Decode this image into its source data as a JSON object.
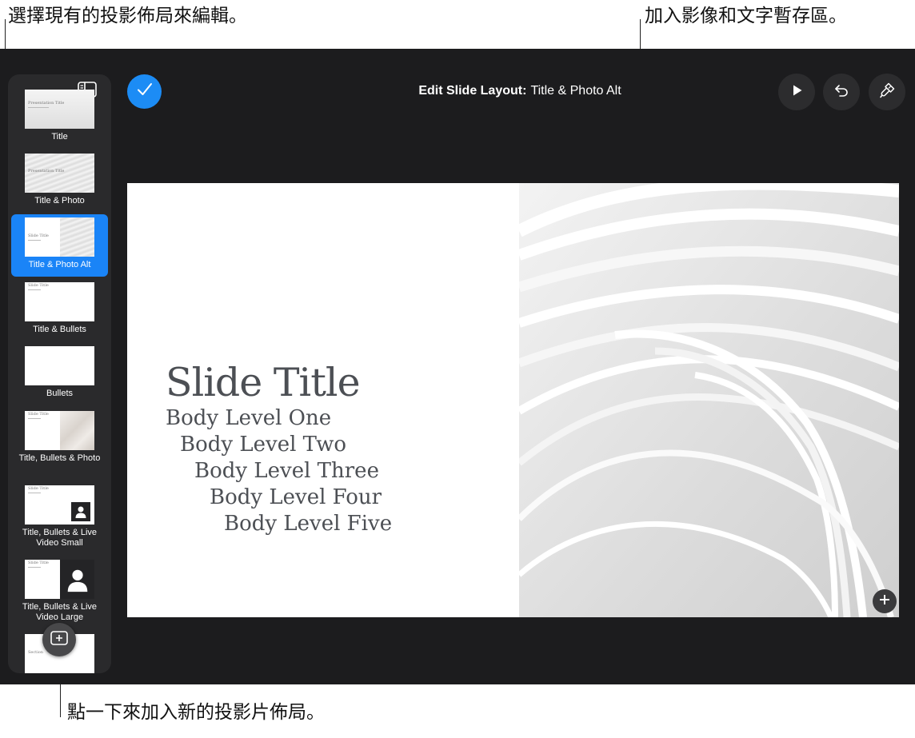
{
  "callouts": {
    "select_layout": "選擇現有的投影佈局來編輯。",
    "add_placeholder": "加入影像和文字暫存區。",
    "add_layout": "點一下來加入新的投影片佈局。"
  },
  "toolbar": {
    "title_bold": "Edit Slide Layout:",
    "title_name": "Title & Photo Alt",
    "done_icon": "checkmark-icon",
    "play_icon": "play-icon",
    "undo_icon": "undo-icon",
    "format_icon": "paintbrush-icon"
  },
  "sidebar": {
    "toggle_icon": "sidebar-icon",
    "add_icon": "add-slide-icon",
    "layouts": [
      {
        "label": "Title",
        "thumb_title": "Presentation Title"
      },
      {
        "label": "Title & Photo",
        "thumb_title": "Presentation Title"
      },
      {
        "label": "Title & Photo Alt",
        "thumb_title": "Slide Title",
        "selected": true
      },
      {
        "label": "Title & Bullets",
        "thumb_title": "Slide Title"
      },
      {
        "label": "Bullets"
      },
      {
        "label": "Title, Bullets & Photo",
        "thumb_title": "Slide Title"
      },
      {
        "label": "Title, Bullets & Live Video Small",
        "thumb_title": "Slide Title"
      },
      {
        "label": "Title, Bullets & Live Video Large",
        "thumb_title": "Slide Title"
      },
      {
        "thumb_title": "Section"
      }
    ]
  },
  "slide": {
    "title": "Slide Title",
    "body": [
      "Body Level One",
      "Body Level Two",
      "Body Level Three",
      "Body Level Four",
      "Body Level Five"
    ]
  },
  "colors": {
    "accent": "#1a84f7",
    "app_background": "#1c1c1e",
    "sidebar_background": "#2a2a2c",
    "slide_text": "#4c4f54"
  }
}
